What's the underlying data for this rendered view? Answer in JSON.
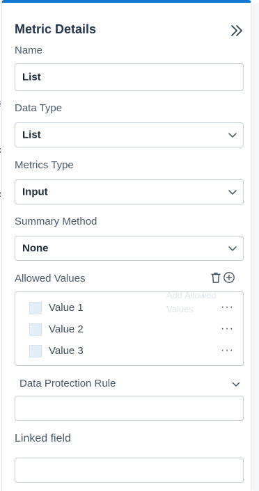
{
  "panel": {
    "title": "Metric Details",
    "collapse_icon": "double-chevron-right-icon"
  },
  "fields": {
    "name": {
      "label": "Name",
      "value": "List"
    },
    "data_type": {
      "label": "Data Type",
      "value": "List"
    },
    "metrics_type": {
      "label": "Metrics Type",
      "value": "Input"
    },
    "summary_method": {
      "label": "Summary Method",
      "value": "None"
    }
  },
  "allowed_values": {
    "label": "Allowed Values",
    "delete_icon": "trash-icon",
    "add_icon": "plus-circle-icon",
    "ghost_text": "Add Allowed Values",
    "items": [
      {
        "label": "Value 1",
        "checked": false
      },
      {
        "label": "Value 2",
        "checked": false
      },
      {
        "label": "Value 3",
        "checked": false
      }
    ],
    "more_glyph": "···"
  },
  "data_protection": {
    "label": "Data Protection Rule",
    "value": ""
  },
  "linked_field": {
    "label": "Linked field",
    "value": ""
  },
  "colors": {
    "accent": "#1677d2",
    "checkbox_fill": "#e4eef8"
  }
}
